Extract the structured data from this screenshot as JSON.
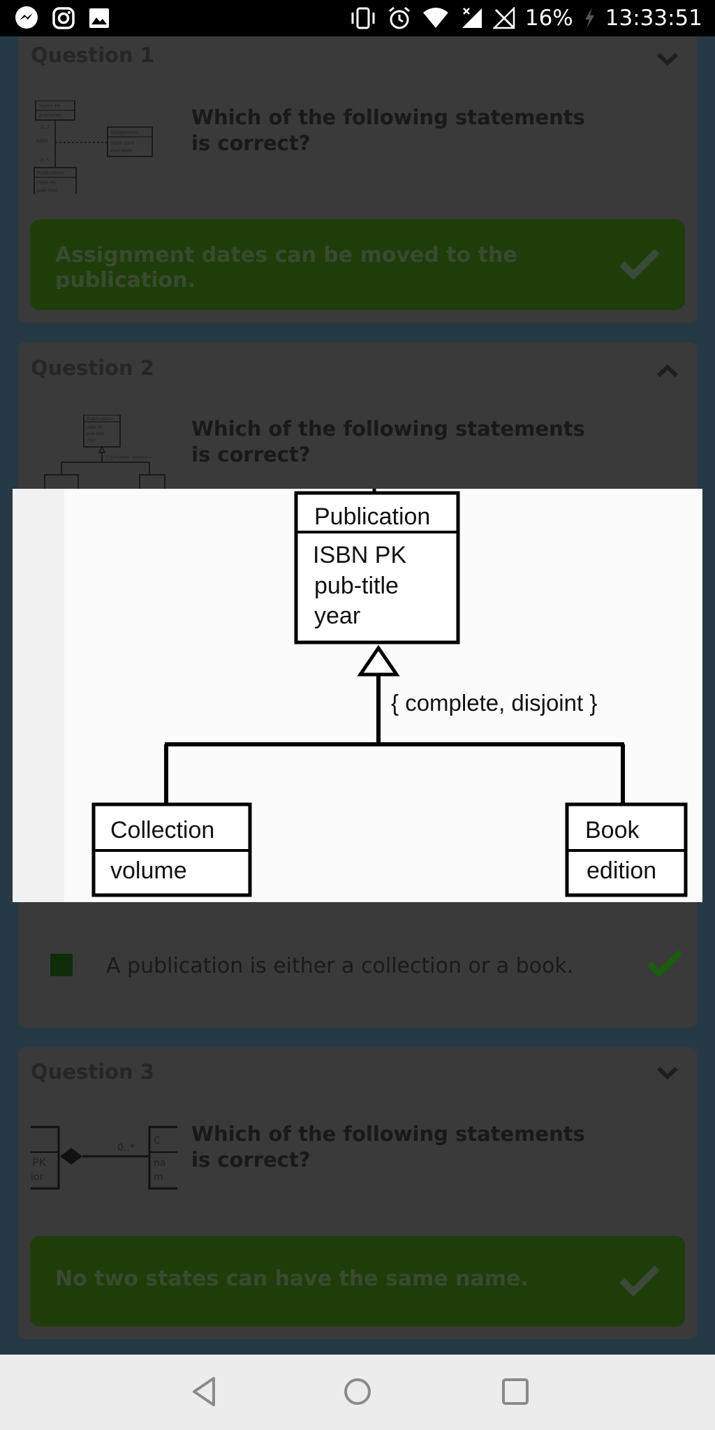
{
  "status_bar": {
    "battery": "16%",
    "time": "13:33:51",
    "left_icons": [
      "messenger-icon",
      "instagram-icon",
      "gallery-icon"
    ],
    "right_icons": [
      "vibrate-icon",
      "alarm-icon",
      "wifi-icon",
      "signal-icon",
      "no-signal-icon",
      "charging-icon"
    ]
  },
  "questions": [
    {
      "title": "Question 1",
      "expanded": false,
      "text": "Which of the following statements is correct?",
      "answer": "Assignment dates can be moved to the publication.",
      "thumb": {
        "box1": [
          "name PK",
          "publisher"
        ],
        "mult1": "1..1",
        "label": "Edits",
        "box2": [
          "Assignment",
          "start-date",
          "end-date"
        ],
        "mult2": "0..*",
        "box3": [
          "Publication",
          "ISBN PK",
          "pub-title"
        ]
      }
    },
    {
      "title": "Question 2",
      "expanded": true,
      "text": "Which of the following statements is correct?",
      "answer": "A publication is either a collection or a book.",
      "thumb": {
        "box": [
          "Publication",
          "ISBN PK",
          "pub-title",
          "year"
        ],
        "constraint": "{ complete, disjoint }"
      }
    },
    {
      "title": "Question 3",
      "expanded": false,
      "text": "Which of the following statements is correct?",
      "answer": "No two states can have the same name.",
      "thumb": {
        "left": [
          "PK",
          "ior"
        ],
        "mult": "0..*",
        "right": [
          "C",
          "na",
          "m"
        ]
      }
    }
  ],
  "diagram": {
    "parent": {
      "name": "Publication",
      "attributes": [
        "ISBN  PK",
        "pub-title",
        "year"
      ]
    },
    "constraint": "{ complete, disjoint }",
    "children": [
      {
        "name": "Collection",
        "attribute": "volume"
      },
      {
        "name": "Book",
        "attribute": "edition"
      }
    ]
  },
  "nav": {
    "buttons": [
      "back-icon",
      "home-icon",
      "recents-icon"
    ]
  },
  "colors": {
    "correct_green": "#1f3d0a",
    "check_green": "#1c5c0c",
    "status_bar": "#000000",
    "nav_bar": "#ececec"
  }
}
